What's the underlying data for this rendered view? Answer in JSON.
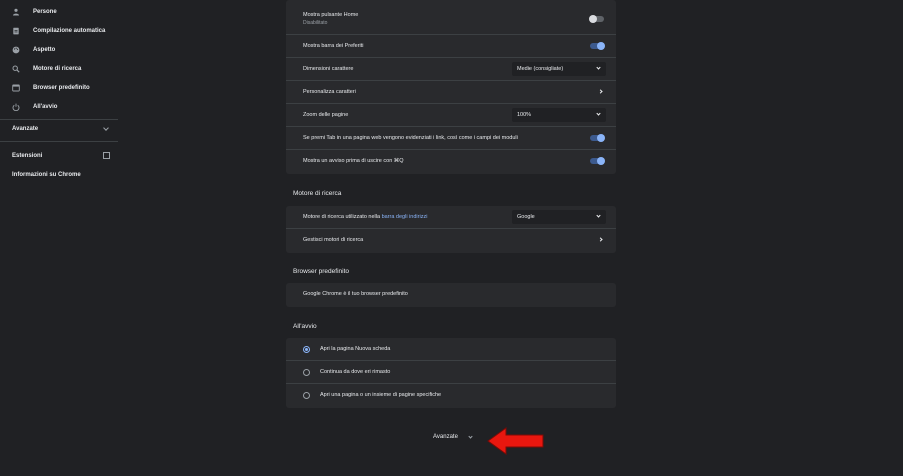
{
  "sidebar": {
    "items": [
      {
        "label": "Persone",
        "icon": "person-icon"
      },
      {
        "label": "Compilazione automatica",
        "icon": "clipboard-icon"
      },
      {
        "label": "Aspetto",
        "icon": "palette-icon"
      },
      {
        "label": "Motore di ricerca",
        "icon": "search-icon"
      },
      {
        "label": "Browser predefinito",
        "icon": "browser-icon"
      },
      {
        "label": "All'avvio",
        "icon": "power-icon"
      }
    ],
    "advanced_label": "Avanzate",
    "extensions_label": "Estensioni",
    "about_label": "Informazioni su Chrome"
  },
  "appearance": {
    "home_button_label": "Mostra pulsante Home",
    "home_button_sub": "Disabilitato",
    "home_button_on": false,
    "bookmarks_bar_label": "Mostra barra dei Preferiti",
    "bookmarks_bar_on": true,
    "font_size_label": "Dimensioni carattere",
    "font_size_value": "Medie (consigliate)",
    "customize_fonts_label": "Personalizza caratteri",
    "zoom_label": "Zoom delle pagine",
    "zoom_value": "100%",
    "tab_highlight_label": "Se premi Tab in una pagina web vengono evidenziati i link, così come i campi dei moduli",
    "tab_highlight_on": true,
    "quit_warning_label": "Mostra un avviso prima di uscire con ⌘Q",
    "quit_warning_on": true
  },
  "search_engine": {
    "title": "Motore di ricerca",
    "engine_label_prefix": "Motore di ricerca utilizzato nella ",
    "engine_label_link": "barra degli indirizzi",
    "engine_value": "Google",
    "manage_label": "Gestisci motori di ricerca"
  },
  "default_browser": {
    "title": "Browser predefinito",
    "status": "Google Chrome è il tuo browser predefinito"
  },
  "on_startup": {
    "title": "All'avvio",
    "options": [
      {
        "label": "Apri la pagina Nuova scheda",
        "checked": true
      },
      {
        "label": "Continua da dove eri rimasto",
        "checked": false
      },
      {
        "label": "Apri una pagina o un insieme di pagine specifiche",
        "checked": false
      }
    ]
  },
  "footer": {
    "advanced_label": "Avanzate"
  },
  "colors": {
    "background": "#202124",
    "card": "#292a2d",
    "accent": "#8ab4f8",
    "annotation_arrow": "#e8170f"
  }
}
